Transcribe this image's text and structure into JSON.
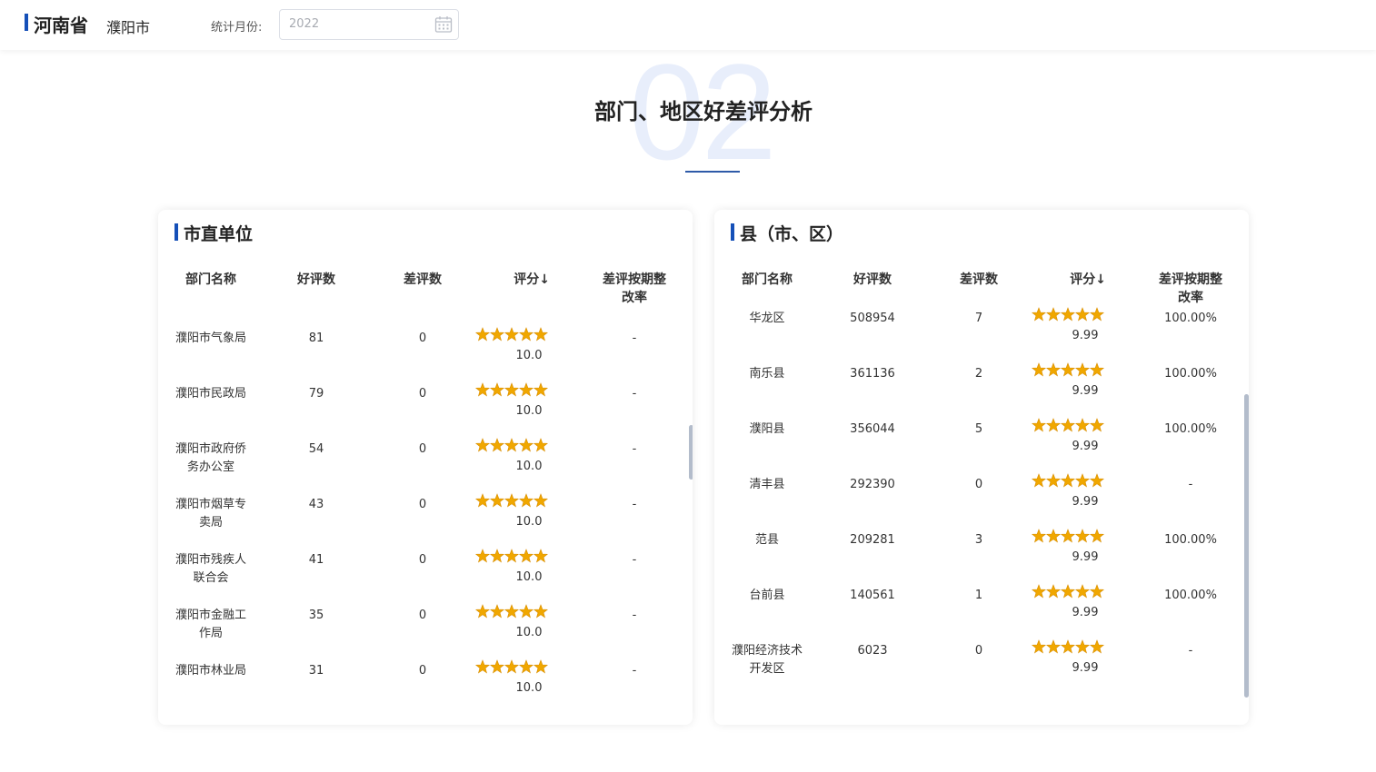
{
  "header": {
    "province": "河南省",
    "city": "濮阳市",
    "month_label": "统计月份:",
    "month_value": "2022"
  },
  "section": {
    "number": "02",
    "title": "部门、地区好差评分析"
  },
  "star_color": "#f0a700",
  "left_panel": {
    "title": "市直单位",
    "columns": [
      "部门名称",
      "好评数",
      "差评数",
      "评分↓",
      "差评按期整\n改率"
    ],
    "rows": [
      {
        "name": [
          "濮阳市气象局"
        ],
        "good": "81",
        "bad": "0",
        "stars": 5,
        "score": "10.0",
        "rate": "-"
      },
      {
        "name": [
          "濮阳市民政局"
        ],
        "good": "79",
        "bad": "0",
        "stars": 5,
        "score": "10.0",
        "rate": "-"
      },
      {
        "name": [
          "濮阳市政府侨",
          "务办公室"
        ],
        "good": "54",
        "bad": "0",
        "stars": 5,
        "score": "10.0",
        "rate": "-"
      },
      {
        "name": [
          "濮阳市烟草专",
          "卖局"
        ],
        "good": "43",
        "bad": "0",
        "stars": 5,
        "score": "10.0",
        "rate": "-"
      },
      {
        "name": [
          "濮阳市残疾人",
          "联合会"
        ],
        "good": "41",
        "bad": "0",
        "stars": 5,
        "score": "10.0",
        "rate": "-"
      },
      {
        "name": [
          "濮阳市金融工",
          "作局"
        ],
        "good": "35",
        "bad": "0",
        "stars": 5,
        "score": "10.0",
        "rate": "-"
      },
      {
        "name": [
          "濮阳市林业局"
        ],
        "good": "31",
        "bad": "0",
        "stars": 5,
        "score": "10.0",
        "rate": "-"
      }
    ]
  },
  "right_panel": {
    "title": "县（市、区）",
    "columns": [
      "部门名称",
      "好评数",
      "差评数",
      "评分↓",
      "差评按期整\n改率"
    ],
    "rows": [
      {
        "name": [
          "华龙区"
        ],
        "good": "508954",
        "bad": "7",
        "stars": 5,
        "score": "9.99",
        "rate": "100.00%"
      },
      {
        "name": [
          "南乐县"
        ],
        "good": "361136",
        "bad": "2",
        "stars": 5,
        "score": "9.99",
        "rate": "100.00%"
      },
      {
        "name": [
          "濮阳县"
        ],
        "good": "356044",
        "bad": "5",
        "stars": 5,
        "score": "9.99",
        "rate": "100.00%"
      },
      {
        "name": [
          "清丰县"
        ],
        "good": "292390",
        "bad": "0",
        "stars": 5,
        "score": "9.99",
        "rate": "-"
      },
      {
        "name": [
          "范县"
        ],
        "good": "209281",
        "bad": "3",
        "stars": 5,
        "score": "9.99",
        "rate": "100.00%"
      },
      {
        "name": [
          "台前县"
        ],
        "good": "140561",
        "bad": "1",
        "stars": 5,
        "score": "9.99",
        "rate": "100.00%"
      },
      {
        "name": [
          "濮阳经济技术",
          "开发区"
        ],
        "good": "6023",
        "bad": "0",
        "stars": 5,
        "score": "9.99",
        "rate": "-"
      }
    ]
  }
}
